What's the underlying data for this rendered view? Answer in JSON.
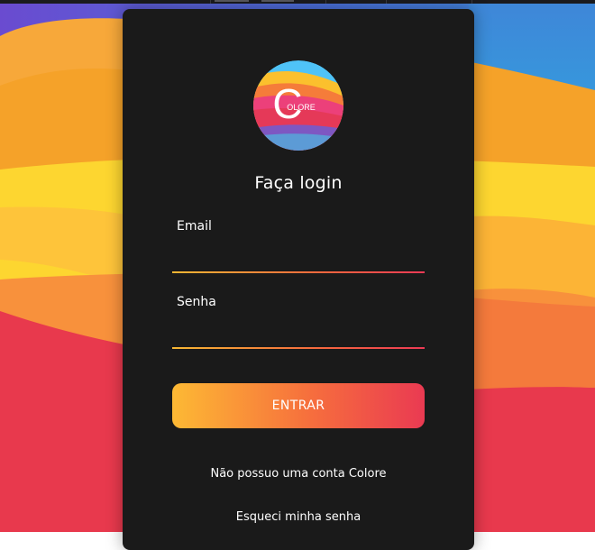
{
  "login": {
    "logo_text": "OLORE",
    "logo_letter": "C",
    "title": "Faça login",
    "email_label": "Email",
    "email_value": "",
    "password_label": "Senha",
    "password_value": "",
    "submit_label": "ENTRAR",
    "no_account_link": "Não possuo uma conta Colore",
    "forgot_password_link": "Esqueci minha senha"
  },
  "colors": {
    "card_background": "#1a1a1a",
    "gradient_start": "#fdb934",
    "gradient_mid": "#f66e3d",
    "gradient_end": "#ea3a52",
    "wallpaper_red": "#e8394d",
    "wallpaper_orange": "#f79a2f",
    "wallpaper_yellow": "#fdd835",
    "wallpaper_blue": "#3a8fd8"
  }
}
